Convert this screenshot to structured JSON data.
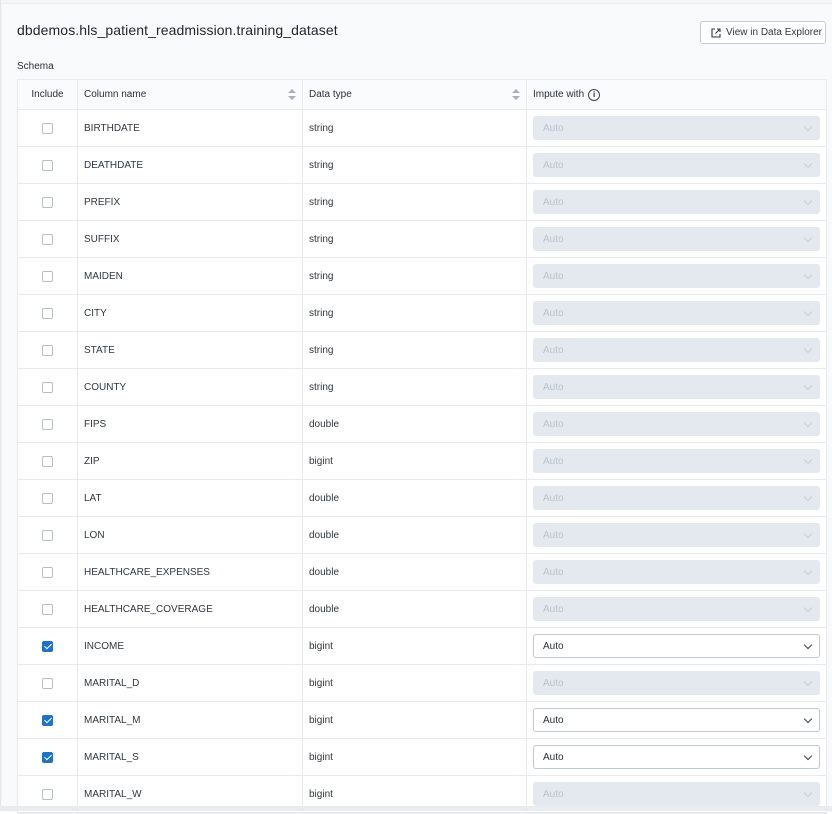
{
  "header": {
    "title": "dbdemos.hls_patient_readmission.training_dataset",
    "view_button": "View in Data Explorer"
  },
  "schema_label": "Schema",
  "columns": {
    "include": "Include",
    "column_name": "Column name",
    "data_type": "Data type",
    "impute_with": "Impute with"
  },
  "rows": [
    {
      "name": "BIRTHDATE",
      "type": "string",
      "included": false,
      "impute": "Auto"
    },
    {
      "name": "DEATHDATE",
      "type": "string",
      "included": false,
      "impute": "Auto"
    },
    {
      "name": "PREFIX",
      "type": "string",
      "included": false,
      "impute": "Auto"
    },
    {
      "name": "SUFFIX",
      "type": "string",
      "included": false,
      "impute": "Auto"
    },
    {
      "name": "MAIDEN",
      "type": "string",
      "included": false,
      "impute": "Auto"
    },
    {
      "name": "CITY",
      "type": "string",
      "included": false,
      "impute": "Auto"
    },
    {
      "name": "STATE",
      "type": "string",
      "included": false,
      "impute": "Auto"
    },
    {
      "name": "COUNTY",
      "type": "string",
      "included": false,
      "impute": "Auto"
    },
    {
      "name": "FIPS",
      "type": "double",
      "included": false,
      "impute": "Auto"
    },
    {
      "name": "ZIP",
      "type": "bigint",
      "included": false,
      "impute": "Auto"
    },
    {
      "name": "LAT",
      "type": "double",
      "included": false,
      "impute": "Auto"
    },
    {
      "name": "LON",
      "type": "double",
      "included": false,
      "impute": "Auto"
    },
    {
      "name": "HEALTHCARE_EXPENSES",
      "type": "double",
      "included": false,
      "impute": "Auto"
    },
    {
      "name": "HEALTHCARE_COVERAGE",
      "type": "double",
      "included": false,
      "impute": "Auto"
    },
    {
      "name": "INCOME",
      "type": "bigint",
      "included": true,
      "impute": "Auto"
    },
    {
      "name": "MARITAL_D",
      "type": "bigint",
      "included": false,
      "impute": "Auto"
    },
    {
      "name": "MARITAL_M",
      "type": "bigint",
      "included": true,
      "impute": "Auto"
    },
    {
      "name": "MARITAL_S",
      "type": "bigint",
      "included": true,
      "impute": "Auto"
    },
    {
      "name": "MARITAL_W",
      "type": "bigint",
      "included": false,
      "impute": "Auto"
    }
  ],
  "colors": {
    "checkbox_checked": "#2072c3",
    "disabled_select_bg": "#e4e9ef"
  },
  "icons": {
    "view_button": "external-link-icon",
    "impute_info": "info-icon",
    "sort": "sort-icon",
    "select": "chevron-down-icon"
  }
}
